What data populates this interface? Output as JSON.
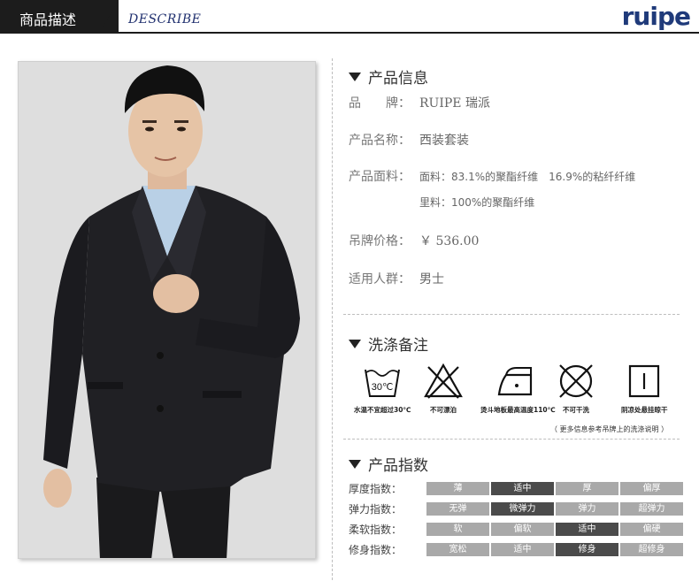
{
  "header": {
    "tab_title": "商品描述",
    "subtitle": "DESCRIBE",
    "brand_logo": "ruipe"
  },
  "info": {
    "section_title": "产品信息",
    "rows": [
      {
        "label": "品　　牌：",
        "value": "RUIPE 瑞派"
      },
      {
        "label": "产品名称：",
        "value": "西装套装"
      },
      {
        "label": "产品面料：",
        "value": "面料：83.1%的聚酯纤维　16.9%的粘纤纤维"
      },
      {
        "label": "",
        "value": "里料：100%的聚酯纤维"
      },
      {
        "label": "吊牌价格：",
        "value": "￥ 536.00"
      },
      {
        "label": "适用人群：",
        "value": "男士"
      }
    ]
  },
  "care": {
    "section_title": "洗涤备注",
    "items": [
      {
        "icon": "wash-30-icon",
        "caption": "水温不宜超过30℃",
        "temp": "30℃"
      },
      {
        "icon": "no-bleach-icon",
        "caption": "不可漂泊"
      },
      {
        "icon": "iron-icon",
        "caption": "烫斗地板最高温度110℃"
      },
      {
        "icon": "no-wash-icon",
        "caption": "不可干洗"
      },
      {
        "icon": "hang-dry-icon",
        "caption": "阴凉处悬挂晾干"
      }
    ],
    "note": "（ 更多信息参考吊牌上的洗涤说明 ）"
  },
  "indices": {
    "section_title": "产品指数",
    "rows": [
      {
        "label": "厚度指数：",
        "options": [
          "薄",
          "适中",
          "厚",
          "偏厚"
        ],
        "selected": 1
      },
      {
        "label": "弹力指数：",
        "options": [
          "无弹",
          "微弹力",
          "弹力",
          "超弹力"
        ],
        "selected": 1
      },
      {
        "label": "柔软指数：",
        "options": [
          "软",
          "偏软",
          "适中",
          "偏硬"
        ],
        "selected": 2
      },
      {
        "label": "修身指数：",
        "options": [
          "宽松",
          "适中",
          "修身",
          "超修身"
        ],
        "selected": 2
      }
    ]
  },
  "colors": {
    "header_dark": "#1c1c1c",
    "brand_blue": "#1f3a7a",
    "cell_default": "#a9a9a9",
    "cell_selected": "#4b4b4b"
  }
}
